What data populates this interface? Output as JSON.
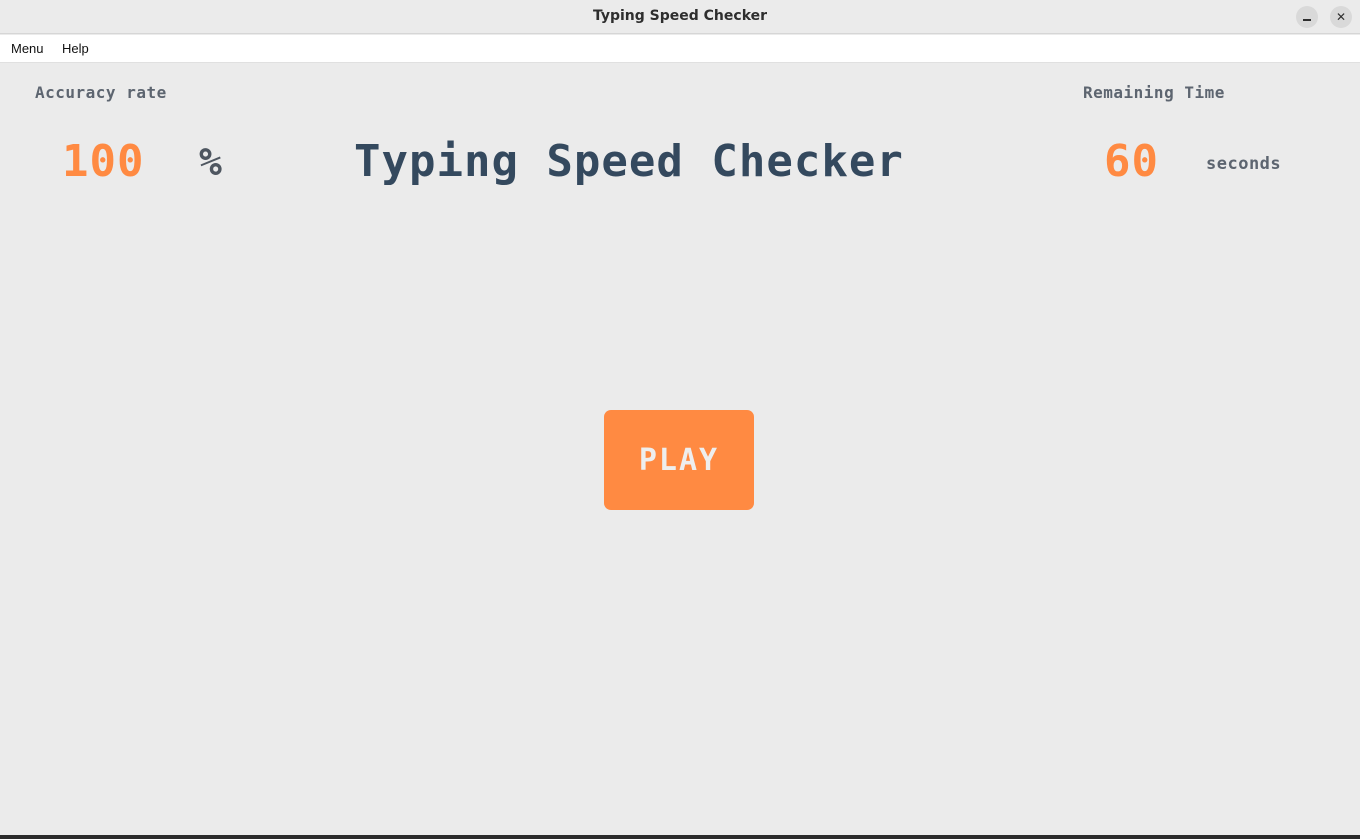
{
  "window": {
    "title": "Typing Speed Checker",
    "minimize_icon": "minimize-icon",
    "close_icon": "close-icon",
    "close_glyph": "✕"
  },
  "menubar": {
    "items": [
      "Menu",
      "Help"
    ]
  },
  "stats": {
    "accuracy_label": "Accuracy rate",
    "accuracy_value": "100",
    "accuracy_unit": "%",
    "time_label": "Remaining Time",
    "time_value": "60",
    "time_unit": "seconds"
  },
  "main": {
    "title": "Typing Speed Checker",
    "play_label": "PLAY"
  },
  "colors": {
    "accent": "#ff8a42",
    "title": "#34495e",
    "background": "#ebebeb"
  }
}
